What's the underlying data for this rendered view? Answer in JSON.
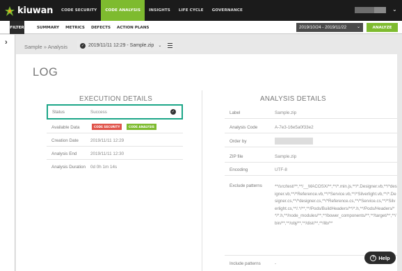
{
  "brand": {
    "name": "kiuwan"
  },
  "topnav": {
    "items": [
      {
        "label": "CODE SECURITY"
      },
      {
        "label": "CODE ANALYSIS"
      },
      {
        "label": "INSIGHTS"
      },
      {
        "label": "LIFE CYCLE"
      },
      {
        "label": "GOVERNANCE"
      }
    ],
    "active": "CODE ANALYSIS"
  },
  "subbar": {
    "filter_label": "FILTER",
    "items": [
      {
        "label": "SUMMARY"
      },
      {
        "label": "METRICS"
      },
      {
        "label": "DEFECTS"
      },
      {
        "label": "ACTION PLANS"
      }
    ],
    "date_range": "2019/10/24 - 2019/11/22",
    "analyze_label": "ANALYZE"
  },
  "breadcrumb": {
    "path": "Sample » Analysis",
    "selected_analysis": "2019/11/11 12:29 - Sample.zip"
  },
  "page": {
    "title": "LOG"
  },
  "execution": {
    "title": "EXECUTION DETAILS",
    "status_label": "Status",
    "status_value": "Success",
    "available_label": "Available Data",
    "tags": [
      "CODE SECURITY",
      "CODE ANALYSIS"
    ],
    "creation_label": "Creation Date",
    "creation_value": "2019/11/11 12:29",
    "end_label": "Analysis End",
    "end_value": "2019/11/11 12:30",
    "duration_label": "Analysis Duration",
    "duration_value": "0d 0h 1m 14s"
  },
  "analysis": {
    "title": "ANALYSIS DETAILS",
    "label_label": "Label",
    "label_value": "Sample.zip",
    "code_label": "Analysis Code",
    "code_value": "A-7e3-16e5a0f33e2",
    "order_label": "Order by",
    "zip_label": "ZIP file",
    "zip_value": "Sample.zip",
    "encoding_label": "Encoding",
    "encoding_value": "UTF-8",
    "exclude_label": "Exclude patterns",
    "exclude_value": "**/src/test/**,**/__MACOSX/**,**/*.min.js,**/*.Designer.vb,**/*designer.vb,**/*Reference.vb,**/*Service.vb,**/*Silverlight.vb,**/*.Designer.cs,**/*designer.cs,**/*Reference.cs,**/*Service.cs,**/*Silverlight.cs,**/.*/**,**/Pods/BuildHeaders/**/*.h,**/Pods/Headers/**/*.h,**/node_modules/**,**/bower_components/**,**/target/**,**/bin/**,**/obj/**,**/dist/**,**/lib/**",
    "include_label": "Include patterns",
    "include_value": "-"
  },
  "help": {
    "label": "Help"
  },
  "colors": {
    "accent": "#7ebb2f",
    "status_border": "#1aa587",
    "tag_security": "#e0534a",
    "tag_analysis": "#7ebb2f"
  }
}
